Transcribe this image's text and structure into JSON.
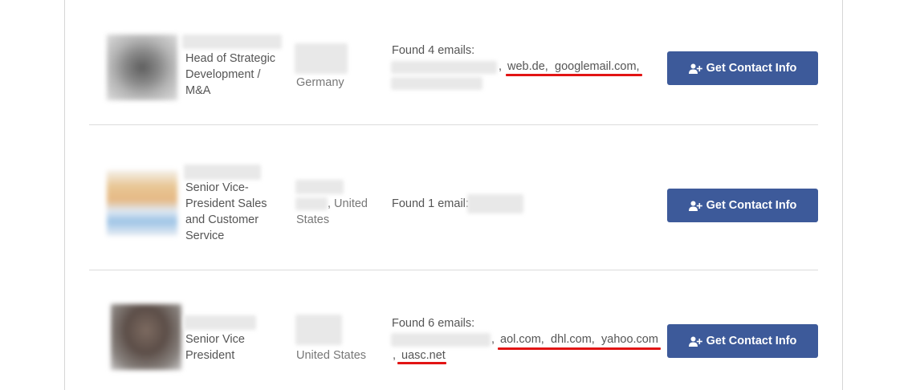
{
  "rows": [
    {
      "title_lines": [
        "Head of Strategic",
        "Development /",
        "M&A"
      ],
      "location": "Germany",
      "found_text": "Found 4 emails:",
      "domains": [
        "web.de,",
        "googlemail.com,"
      ],
      "button_label": "Get Contact Info"
    },
    {
      "title_lines": [
        "Senior Vice-",
        "President Sales",
        "and Customer",
        "Service"
      ],
      "location_suffix": ", United",
      "location_line2": "States",
      "found_text": "Found 1 email:",
      "button_label": "Get Contact Info"
    },
    {
      "title_lines": [
        "Senior Vice",
        "President"
      ],
      "location": "United States",
      "found_text": "Found 6 emails:",
      "domains": [
        "aol.com,",
        "dhl.com,",
        "yahoo.com",
        "uasc.net"
      ],
      "button_label": "Get Contact Info"
    }
  ],
  "icons": {
    "button_icon": "user-plus-icon"
  },
  "colors": {
    "button": "#3d5a9a",
    "underline": "#e21414",
    "divider": "#dcdcdc"
  }
}
